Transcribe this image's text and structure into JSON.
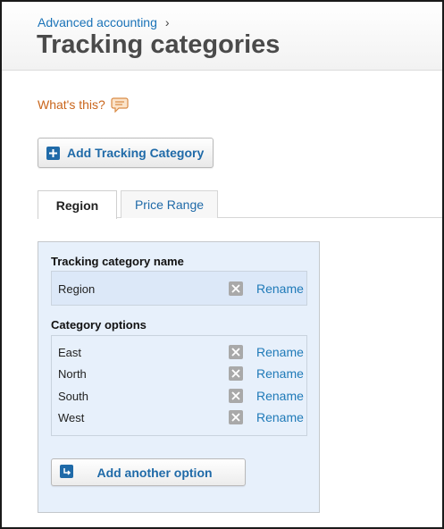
{
  "breadcrumb": {
    "link": "Advanced accounting",
    "separator": "›"
  },
  "page": {
    "title": "Tracking categories"
  },
  "help": {
    "label": "What's this?",
    "icon": "speech-bubble-icon"
  },
  "toolbar": {
    "add_category_label": "Add Tracking Category",
    "icon": "plus-icon"
  },
  "tabs": [
    {
      "label": "Region",
      "active": true
    },
    {
      "label": "Price Range",
      "active": false
    }
  ],
  "panel": {
    "name_heading": "Tracking category name",
    "name_value": "Region",
    "options_heading": "Category options",
    "options": [
      {
        "label": "East"
      },
      {
        "label": "North"
      },
      {
        "label": "South"
      },
      {
        "label": "West"
      }
    ],
    "rename_label": "Rename",
    "delete_icon": "delete-icon",
    "add_option_label": "Add another option",
    "add_option_icon": "return-arrow-icon"
  },
  "colors": {
    "link_blue": "#1f6aa8",
    "help_orange": "#c9651b",
    "panel_bg": "#e7f0fb",
    "title_gray": "#4a4a4a"
  }
}
